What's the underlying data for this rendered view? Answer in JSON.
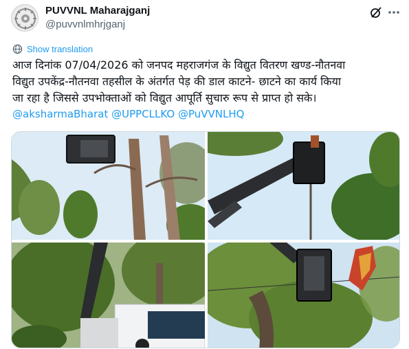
{
  "account": {
    "display_name": "PUVVNL Maharajganj",
    "handle": "@puvvnlmhrjganj"
  },
  "icons": {
    "grok": "grok-icon",
    "more": "more-horizontal-icon",
    "translate": "globe-icon"
  },
  "translate": {
    "label": "Show translation"
  },
  "post": {
    "line1": "आज दिनांक 07/04/2026 को जनपद महराजगंज के विद्युत वितरण खण्ड-नौतनवा",
    "line2": "विद्युत उपकेंद्र-नौतनवा तहसील के अंतर्गत पेड़ की डाल काटने-  छाटने का कार्य किया",
    "line3": "जा रहा है जिससे उपभोक्ताओं को विद्युत आपूर्ति सुचारु रूप से प्राप्त हो सके।",
    "mentions": [
      "@aksharmaBharat",
      "@UPPCLLKO",
      "@PuVVNLHQ"
    ]
  },
  "colors": {
    "link": "#1d9bf0",
    "text": "#0f1419",
    "secondary": "#536471",
    "border": "#cfd9de",
    "sky": "#d9ecf7",
    "foliage": "#4f7a2c"
  }
}
